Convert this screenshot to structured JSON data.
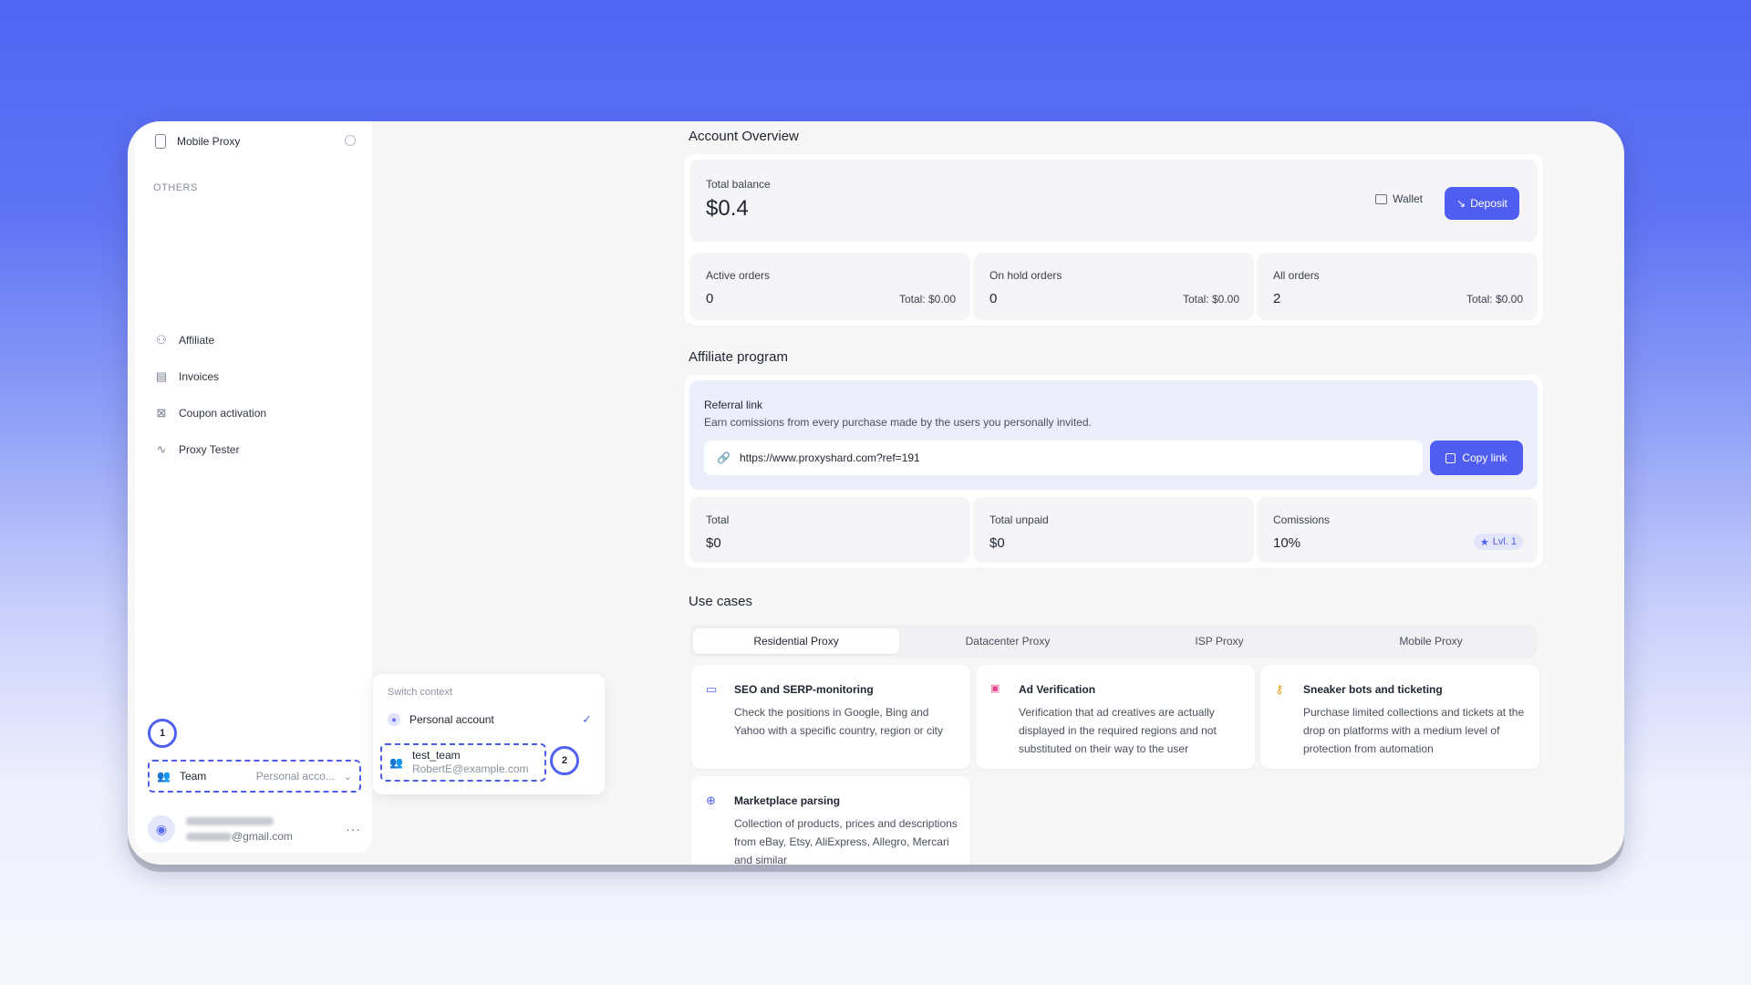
{
  "sidebar": {
    "top_item": "Mobile Proxy",
    "section_label": "OTHERS",
    "items": [
      {
        "label": "Affiliate",
        "icon": "affiliate-icon"
      },
      {
        "label": "Invoices",
        "icon": "invoice-icon"
      },
      {
        "label": "Coupon activation",
        "icon": "coupon-icon"
      },
      {
        "label": "Proxy Tester",
        "icon": "pulse-icon"
      }
    ],
    "team_select": {
      "label": "Team",
      "value": "Personal acco..."
    },
    "user": {
      "email_suffix": "@gmail.com"
    }
  },
  "annotations": {
    "one": "1",
    "two": "2"
  },
  "context_popup": {
    "title": "Switch context",
    "personal": "Personal account",
    "team_name": "test_team",
    "team_email": "RobertE@example.com"
  },
  "account_overview": {
    "heading": "Account Overview",
    "balance_label": "Total balance",
    "balance_value": "$0.4",
    "wallet_label": "Wallet",
    "deposit_label": "Deposit",
    "stats": [
      {
        "label": "Active orders",
        "value": "0",
        "total": "Total: $0.00"
      },
      {
        "label": "On hold orders",
        "value": "0",
        "total": "Total: $0.00"
      },
      {
        "label": "All orders",
        "value": "2",
        "total": "Total: $0.00"
      }
    ]
  },
  "affiliate": {
    "heading": "Affiliate program",
    "ref_title": "Referral link",
    "ref_desc": "Earn comissions from every purchase made by the users you personally invited.",
    "ref_url": "https://www.proxyshard.com?ref=191",
    "copy_label": "Copy link",
    "stats": [
      {
        "label": "Total",
        "value": "$0"
      },
      {
        "label": "Total unpaid",
        "value": "$0"
      },
      {
        "label": "Comissions",
        "value": "10%",
        "badge": "Lvl. 1"
      }
    ]
  },
  "use_cases": {
    "heading": "Use cases",
    "tabs": [
      "Residential Proxy",
      "Datacenter Proxy",
      "ISP Proxy",
      "Mobile Proxy"
    ],
    "active_tab": "Residential Proxy",
    "cards": [
      {
        "title": "SEO and SERP-monitoring",
        "desc": "Check the positions in Google, Bing and Yahoo with a specific country, region or city",
        "icon": "browser-icon",
        "color": "#4f5ef0"
      },
      {
        "title": "Ad Verification",
        "desc": "Verification that ad creatives are actually displayed in the required regions and not substituted on their way to the user",
        "icon": "ad-icon",
        "color": "#e0448c"
      },
      {
        "title": "Sneaker bots and ticketing",
        "desc": "Purchase limited collections and tickets at the drop on platforms with a medium level of protection from automation",
        "icon": "user-key-icon",
        "color": "#e6a21b"
      },
      {
        "title": "Marketplace parsing",
        "desc": "Collection of products, prices and descriptions from eBay, Etsy, AliExpress, Allegro, Mercari and similar",
        "icon": "globe-icon",
        "color": "#4f5ef0"
      }
    ]
  },
  "colors": {
    "accent": "#4f5ef0",
    "background_top": "#5065f2"
  }
}
